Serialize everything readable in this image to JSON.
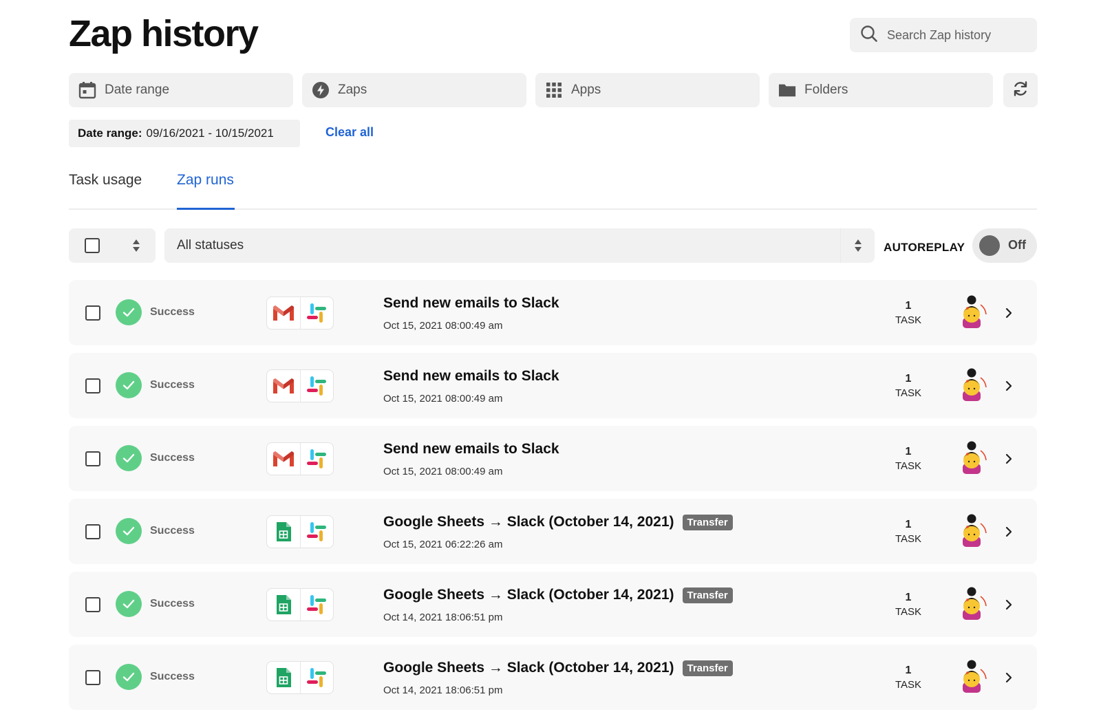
{
  "page": {
    "title": "Zap history"
  },
  "search": {
    "placeholder": "Search Zap history"
  },
  "filters": {
    "date_range": "Date range",
    "zaps": "Zaps",
    "apps": "Apps",
    "folders": "Folders"
  },
  "active_filter": {
    "label": "Date range:",
    "value": "09/16/2021 - 10/15/2021",
    "clear": "Clear all"
  },
  "tabs": [
    {
      "label": "Task usage",
      "active": false
    },
    {
      "label": "Zap runs",
      "active": true
    }
  ],
  "toolbar": {
    "status_select": "All statuses",
    "autoreplay_label": "AUTOREPLAY",
    "autoreplay_state": "Off"
  },
  "colors": {
    "accent": "#1f63d4",
    "success": "#5fcf88",
    "badge": "#6f6f6f"
  },
  "runs": [
    {
      "status": "Success",
      "apps": [
        "gmail-icon",
        "slack-icon"
      ],
      "title": "Send new emails to Slack",
      "badge": "",
      "time": "Oct 15, 2021 08:00:49 am",
      "tasks": "1",
      "task_label": "TASK"
    },
    {
      "status": "Success",
      "apps": [
        "gmail-icon",
        "slack-icon"
      ],
      "title": "Send new emails to Slack",
      "badge": "",
      "time": "Oct 15, 2021 08:00:49 am",
      "tasks": "1",
      "task_label": "TASK"
    },
    {
      "status": "Success",
      "apps": [
        "gmail-icon",
        "slack-icon"
      ],
      "title": "Send new emails to Slack",
      "badge": "",
      "time": "Oct 15, 2021 08:00:49 am",
      "tasks": "1",
      "task_label": "TASK"
    },
    {
      "status": "Success",
      "apps": [
        "google-sheets-icon",
        "slack-icon"
      ],
      "title": "Google Sheets → Slack (October 14, 2021)",
      "badge": "Transfer",
      "time": "Oct 15, 2021 06:22:26 am",
      "tasks": "1",
      "task_label": "TASK"
    },
    {
      "status": "Success",
      "apps": [
        "google-sheets-icon",
        "slack-icon"
      ],
      "title": "Google Sheets → Slack (October 14, 2021)",
      "badge": "Transfer",
      "time": "Oct 14, 2021 18:06:51 pm",
      "tasks": "1",
      "task_label": "TASK"
    },
    {
      "status": "Success",
      "apps": [
        "google-sheets-icon",
        "slack-icon"
      ],
      "title": "Google Sheets → Slack (October 14, 2021)",
      "badge": "Transfer",
      "time": "Oct 14, 2021 18:06:51 pm",
      "tasks": "1",
      "task_label": "TASK"
    }
  ]
}
